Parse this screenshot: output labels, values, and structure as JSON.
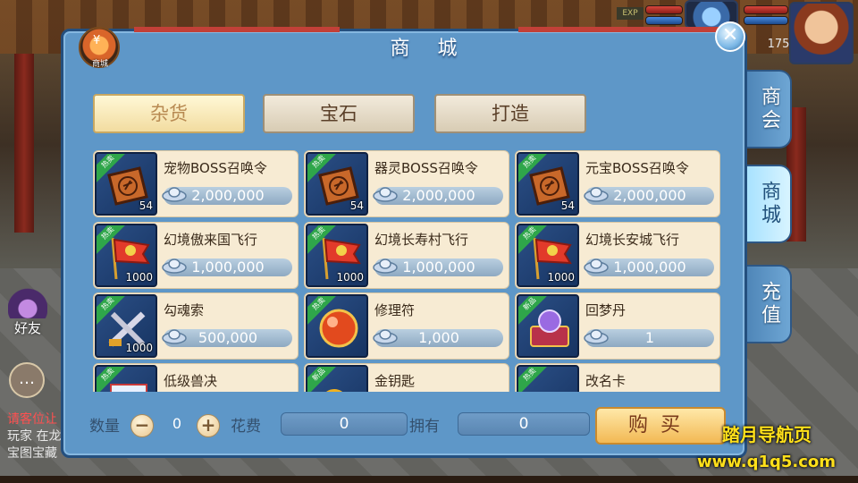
{
  "hud": {
    "exp_label": "EXP",
    "level": "175"
  },
  "left_panel": {
    "friends_label": "好友",
    "chat_lines": [
      "请客位让",
      "玩家 在龙",
      "宝图宝藏"
    ]
  },
  "panel": {
    "title": "商 城",
    "badge_icon": "¥",
    "badge_label": "商城",
    "close_icon": "✕"
  },
  "side_tabs": [
    {
      "label": "商会",
      "active": false
    },
    {
      "label": "商城",
      "active": true
    },
    {
      "label": "充值",
      "active": false
    }
  ],
  "category_tabs": [
    {
      "label": "杂货",
      "active": true
    },
    {
      "label": "宝石",
      "active": false
    },
    {
      "label": "打造",
      "active": false
    }
  ],
  "items": [
    {
      "name": "宠物BOSS召唤令",
      "price": "2,000,000",
      "qty": "54",
      "tag": "热卖",
      "icon": "token-icon"
    },
    {
      "name": "器灵BOSS召唤令",
      "price": "2,000,000",
      "qty": "54",
      "tag": "热卖",
      "icon": "token-icon"
    },
    {
      "name": "元宝BOSS召唤令",
      "price": "2,000,000",
      "qty": "54",
      "tag": "热卖",
      "icon": "token-icon"
    },
    {
      "name": "幻境傲来国飞行",
      "price": "1,000,000",
      "qty": "1000",
      "tag": "热卖",
      "icon": "flag-icon"
    },
    {
      "name": "幻境长寿村飞行",
      "price": "1,000,000",
      "qty": "1000",
      "tag": "热卖",
      "icon": "flag-icon"
    },
    {
      "name": "幻境长安城飞行",
      "price": "1,000,000",
      "qty": "1000",
      "tag": "热卖",
      "icon": "flag-icon"
    },
    {
      "name": "勾魂索",
      "price": "500,000",
      "qty": "1000",
      "tag": "热卖",
      "icon": "hook-rope-icon"
    },
    {
      "name": "修理符",
      "price": "1,000",
      "qty": "",
      "tag": "热卖",
      "icon": "repair-orb-icon"
    },
    {
      "name": "回梦丹",
      "price": "1",
      "qty": "",
      "tag": "新品",
      "icon": "treasure-chest-icon"
    },
    {
      "name": "低级兽决",
      "price": "",
      "qty": "",
      "tag": "热卖",
      "icon": "scroll-icon"
    },
    {
      "name": "金钥匙",
      "price": "",
      "qty": "",
      "tag": "新品",
      "icon": "gold-key-icon"
    },
    {
      "name": "改名卡",
      "price": "",
      "qty": "",
      "tag": "热卖",
      "icon": "rename-card-icon"
    }
  ],
  "purchase": {
    "qty_label": "数量",
    "qty_minus": "−",
    "qty_value": "0",
    "qty_plus": "+",
    "cost_label": "花费",
    "cost_value": "0",
    "own_label": "拥有",
    "own_value": "0",
    "buy_label": "购买"
  },
  "watermark": {
    "line1": "踏月导航页",
    "line2": "www.q1q5.com"
  },
  "colors": {
    "panel_blue": "#5e97c8",
    "card_bg": "#f7ebd3",
    "tag_green": "#2fa64a",
    "buy_gold": "#f2b954",
    "watermark_yellow": "#ffe01a"
  }
}
